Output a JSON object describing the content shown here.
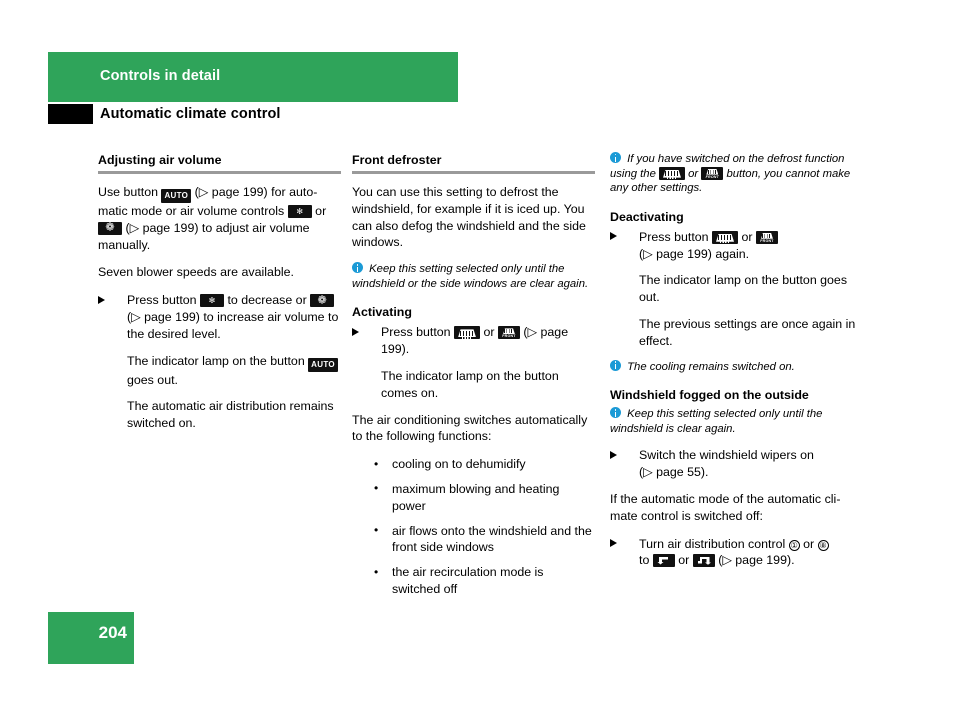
{
  "header": {
    "chapter": "Controls in detail",
    "section": "Automatic climate control"
  },
  "footer": {
    "page_number": "204"
  },
  "colors": {
    "brand_green": "#2fa45a",
    "info_blue": "#1b9ad6",
    "rule_gray": "#9a9a9a",
    "key_black": "#111111"
  },
  "column1": {
    "heading": "Adjusting air volume",
    "para1_a": "Use button",
    "para1_b": "(▷ page 199) for auto-matic mode or air volume controls",
    "para1_c": "or",
    "para1_d": "(▷ page 199) to adjust air volume manually.",
    "para2": "Seven blower speeds are available.",
    "step1_a": "Press button",
    "step1_b": "to decrease or",
    "step1_c": "(▷ page 199) to increase air volume to the desired level.",
    "step1_r1_a": "The indicator lamp on the button",
    "step1_r1_b": "goes out.",
    "step1_r2": "The automatic air distribution remains switched on."
  },
  "column2": {
    "heading": "Front defroster",
    "para1": "You can use this setting to defrost the windshield, for example if it is iced up. You can also defog the windshield and the side windows.",
    "note1": "Keep this setting selected only until the windshield or the side windows are clear again.",
    "sub1": "Activating",
    "step1_a": "Press button",
    "step1_b": "or",
    "step1_c": "(▷ page 199).",
    "step1_r1": "The indicator lamp on the button comes on.",
    "para2": "The air conditioning switches automatically to the following functions:",
    "bullets": [
      "cooling on to dehumidify",
      "maximum blowing and heating power",
      "air flows onto the windshield and the front side windows",
      "the air recirculation mode is switched off"
    ]
  },
  "column3": {
    "note1_a": "If you have switched on the defrost function using the",
    "note1_b": "or",
    "note1_c": "button, you cannot make any other settings.",
    "sub1": "Deactivating",
    "step1_a": "Press button",
    "step1_b": "or",
    "step1_c": "(▷ page 199) again.",
    "step1_r1": "The indicator lamp on the button goes out.",
    "step1_r2": "The previous settings are once again in effect.",
    "note2": "The cooling remains switched on.",
    "sub2": "Windshield fogged on the outside",
    "note3": "Keep this setting selected only until the windshield is clear again.",
    "step2_a": "Switch the windshield wipers on",
    "step2_b": "(▷ page 55).",
    "para1": "If the automatic mode of the automatic cli-mate control is switched off:",
    "step3_a": "Turn air distribution control",
    "step3_num1": "①",
    "step3_or": "or",
    "step3_num2": "⑧",
    "step3_b": "to",
    "step3_c": "or",
    "step3_d": "(▷ page 199)."
  },
  "icons": {
    "auto": "AUTO",
    "fan_low": "fan-low-icon",
    "fan_high": "fan-high-icon",
    "defrost_rear": "rear-defroster-icon",
    "defrost_front": "front-defroster-icon",
    "air_to_footwell": "air-distribution-footwell-icon",
    "air_to_upper": "air-distribution-upper-icon",
    "front_label": "FRONT"
  }
}
